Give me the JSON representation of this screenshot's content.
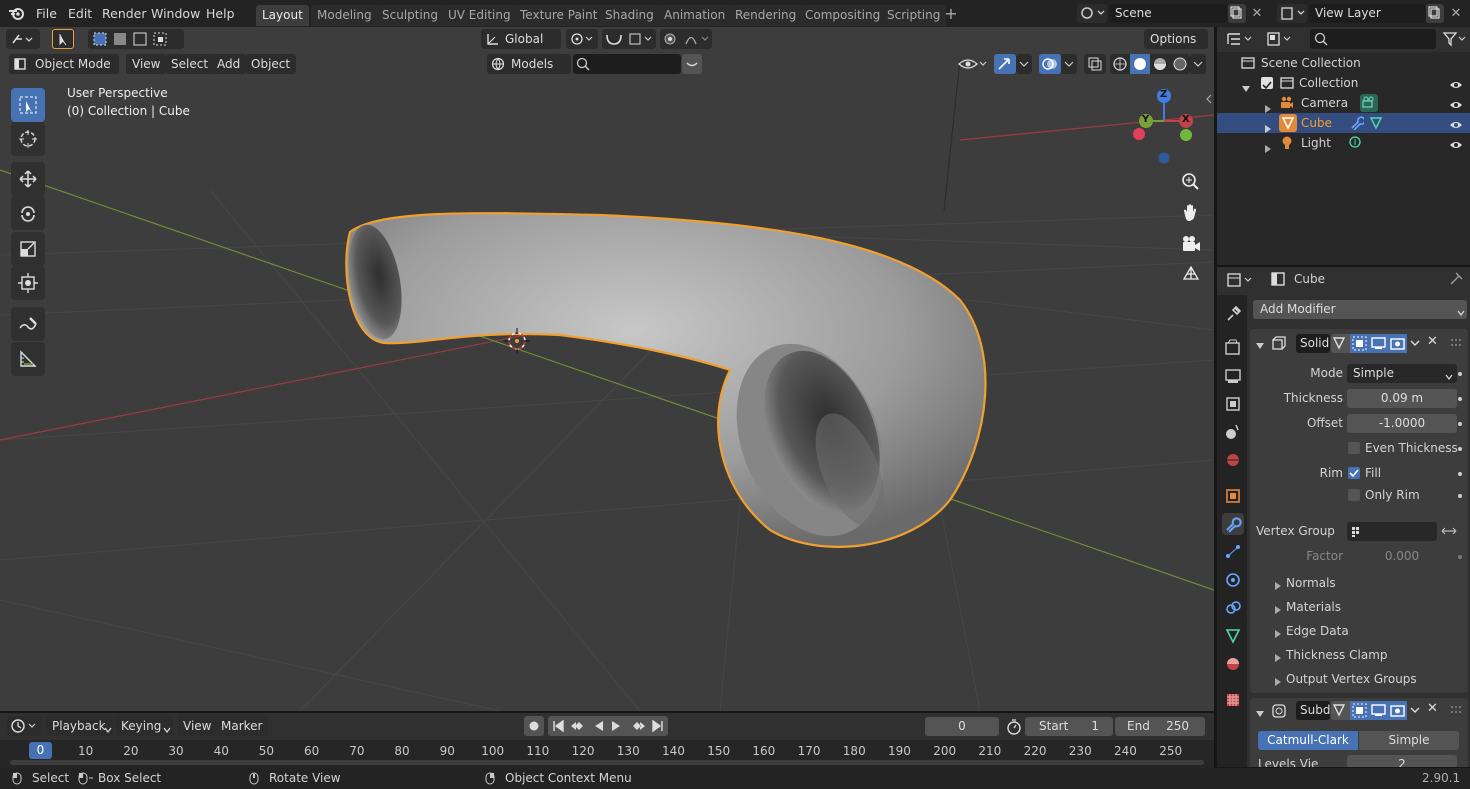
{
  "topbar": {
    "menus": [
      "File",
      "Edit",
      "Render",
      "Window",
      "Help"
    ],
    "workspaces": [
      "Layout",
      "Modeling",
      "Sculpting",
      "UV Editing",
      "Texture Paint",
      "Shading",
      "Animation",
      "Rendering",
      "Compositing",
      "Scripting"
    ],
    "scene": "Scene",
    "view_layer": "View Layer"
  },
  "viewport": {
    "mode": "Object Mode",
    "menus": [
      "View",
      "Select",
      "Add",
      "Object"
    ],
    "orientation": "Global",
    "collection_filter": "Models",
    "options": "Options",
    "overlay_line1": "User Perspective",
    "overlay_line2": "(0) Collection | Cube",
    "gizmo": {
      "z": "Z",
      "y": "Y",
      "x": "X"
    }
  },
  "outliner": {
    "scene_collection": "Scene Collection",
    "collection": "Collection",
    "items": [
      "Camera",
      "Cube",
      "Light"
    ]
  },
  "properties": {
    "object_name": "Cube",
    "add_modifier": "Add Modifier",
    "solidify": {
      "name": "Solid",
      "mode_label": "Mode",
      "mode_value": "Simple",
      "thickness_label": "Thickness",
      "thickness_value": "0.09 m",
      "offset_label": "Offset",
      "offset_value": "-1.0000",
      "even_thickness": "Even Thickness",
      "rim_label": "Rim",
      "fill": "Fill",
      "only_rim": "Only Rim",
      "vertex_group_label": "Vertex Group",
      "factor_label": "Factor",
      "factor_value": "0.000",
      "subpanels": [
        "Normals",
        "Materials",
        "Edge Data",
        "Thickness Clamp",
        "Output Vertex Groups"
      ]
    },
    "subsurf": {
      "name": "Subd",
      "catmull": "Catmull-Clark",
      "simple": "Simple",
      "levels_label": "Levels Vie",
      "levels_value": "2"
    }
  },
  "timeline": {
    "menus": [
      "Playback",
      "Keying",
      "View",
      "Marker"
    ],
    "current_frame": "0",
    "start_label": "Start",
    "start_value": "1",
    "end_label": "End",
    "end_value": "250",
    "ruler": [
      "0",
      "10",
      "20",
      "30",
      "40",
      "50",
      "60",
      "70",
      "80",
      "90",
      "100",
      "110",
      "120",
      "130",
      "140",
      "150",
      "160",
      "170",
      "180",
      "190",
      "200",
      "210",
      "220",
      "230",
      "240",
      "250"
    ]
  },
  "statusbar": {
    "select": "Select",
    "box_select": "Box Select",
    "rotate_view": "Rotate View",
    "context_menu": "Object Context Menu",
    "version": "2.90.1"
  },
  "colors": {
    "accent": "#4772b3",
    "selection_outline": "#f0a030",
    "axis_x": "#c0424a",
    "axis_y": "#7aa03a",
    "axis_z": "#3d7fe0"
  }
}
